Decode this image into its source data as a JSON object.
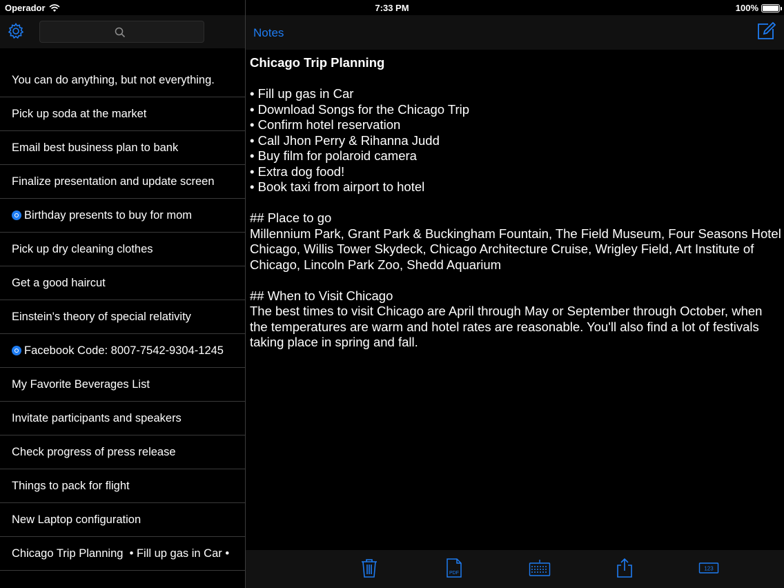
{
  "status_bar": {
    "carrier": "Operador",
    "time": "7:33 PM",
    "battery": "100%"
  },
  "sidebar": {
    "search": {
      "placeholder": ""
    },
    "items": [
      {
        "label": "You can do anything, but not everything.",
        "marked": false
      },
      {
        "label": "Pick up soda at the market",
        "marked": false
      },
      {
        "label": "Email best business plan to bank",
        "marked": false
      },
      {
        "label": "Finalize presentation and update screen",
        "marked": false
      },
      {
        "label": "Birthday presents to buy for mom",
        "marked": true
      },
      {
        "label": "Pick up dry cleaning clothes",
        "marked": false
      },
      {
        "label": "Get a good haircut",
        "marked": false
      },
      {
        "label": "Einstein's theory of special relativity",
        "marked": false
      },
      {
        "label": "Facebook Code: 8007-7542-9304-1245",
        "marked": true
      },
      {
        "label": "My Favorite Beverages List",
        "marked": false
      },
      {
        "label": "Invitate participants and speakers",
        "marked": false
      },
      {
        "label": "Check progress of press release",
        "marked": false
      },
      {
        "label": "Things to pack for flight",
        "marked": false
      },
      {
        "label": "New Laptop configuration",
        "marked": false
      },
      {
        "label": "Chicago Trip Planning  • Fill up gas in Car •",
        "marked": false
      }
    ]
  },
  "header": {
    "back_label": "Notes"
  },
  "note": {
    "title": "Chicago Trip Planning",
    "body": "\n• Fill up gas in Car\n• Download Songs for the Chicago Trip\n• Confirm hotel reservation\n• Call Jhon Perry & Rihanna Judd\n• Buy film for polaroid camera\n• Extra dog food!\n• Book taxi from airport to hotel\n\n## Place to go\nMillennium Park, Grant Park & Buckingham Fountain, The Field Museum, Four Seasons Hotel Chicago, Willis Tower Skydeck, Chicago Architecture Cruise, Wrigley Field, Art Institute of Chicago, Lincoln Park Zoo, Shedd Aquarium\n\n## When to Visit Chicago\nThe best times to visit Chicago are April through May or September through October, when the temperatures are warm and hotel rates are reasonable. You'll also find a lot of festivals taking place in spring and fall."
  },
  "toolbar": {
    "pdf_label": "PDF",
    "numbers_label": "123"
  },
  "colors": {
    "accent": "#1e7cf2",
    "background": "#000000",
    "separator": "#3a3a3a"
  },
  "icons": [
    "wifi-icon",
    "battery-icon",
    "gear-icon",
    "search-icon",
    "compose-icon",
    "trash-icon",
    "pdf-icon",
    "keyboard-icon",
    "share-icon",
    "numbers-icon"
  ]
}
